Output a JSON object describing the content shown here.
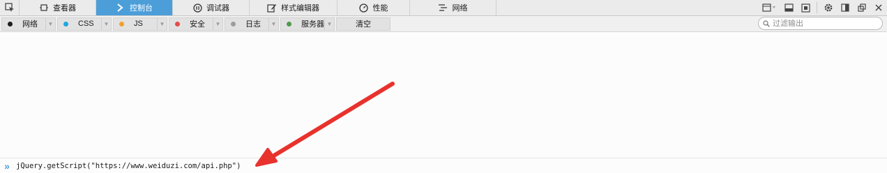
{
  "toolbar": {
    "tabs": [
      {
        "label": "查看器",
        "icon": "inspector-icon"
      },
      {
        "label": "控制台",
        "icon": "console-icon",
        "active": true
      },
      {
        "label": "调试器",
        "icon": "debugger-icon"
      },
      {
        "label": "样式编辑器",
        "icon": "style-editor-icon"
      },
      {
        "label": "性能",
        "icon": "performance-icon"
      },
      {
        "label": "网络",
        "icon": "network-icon"
      }
    ],
    "accent": "#4c9ed9"
  },
  "filters": {
    "items": [
      {
        "label": "网络",
        "color": "#1f1f1f"
      },
      {
        "label": "CSS",
        "color": "#1ea7e0"
      },
      {
        "label": "JS",
        "color": "#f0a030"
      },
      {
        "label": "安全",
        "color": "#e34c4c"
      },
      {
        "label": "日志",
        "color": "#9d9d9d"
      },
      {
        "label": "服务器",
        "color": "#4e9a4e"
      }
    ],
    "clear_label": "清空",
    "search_placeholder": "过滤输出"
  },
  "console": {
    "prompt": "»",
    "command": "jQuery.getScript(\"https://www.weiduzi.com/api.php\")"
  },
  "annotation": {
    "arrow_color": "#e8322d"
  }
}
